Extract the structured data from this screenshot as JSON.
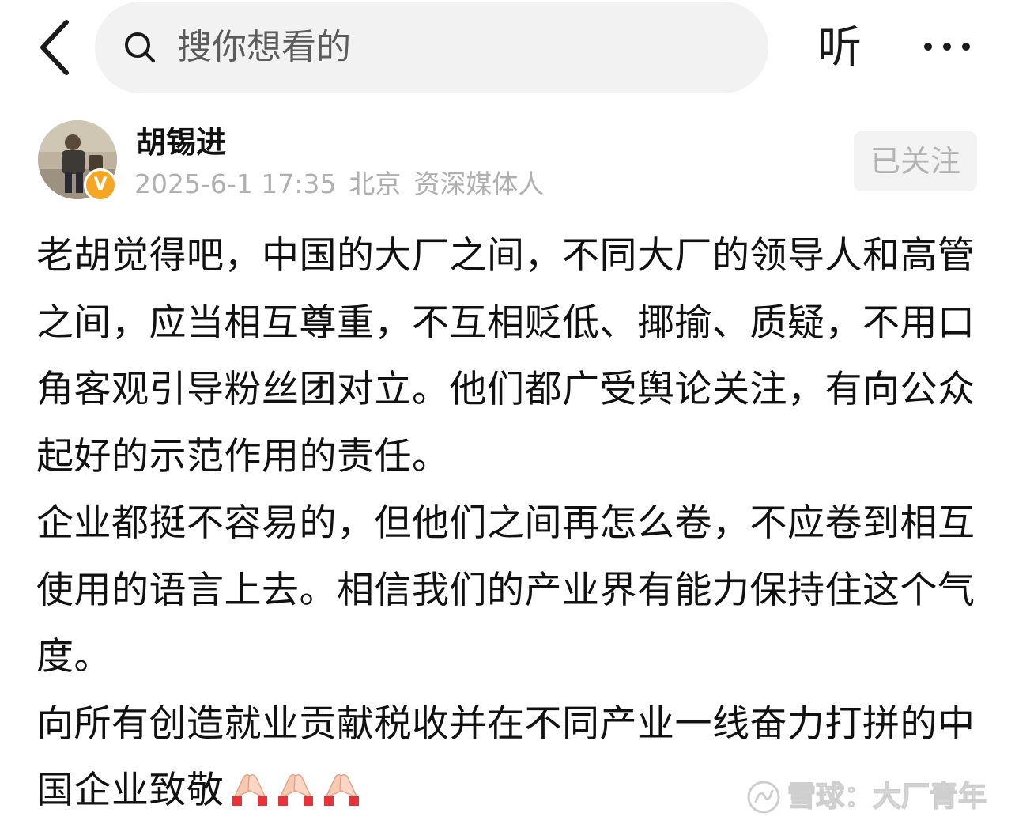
{
  "header": {
    "search_placeholder": "搜你想看的",
    "listen_label": "听"
  },
  "author": {
    "name": "胡锡进",
    "timestamp": "2025-6-1 17:35",
    "location": "北京",
    "title": "资深媒体人",
    "badge": "V",
    "follow_label": "已关注"
  },
  "post": {
    "paragraphs": [
      "老胡觉得吧，中国的大厂之间，不同大厂的领导人和高管之间，应当相互尊重，不互相贬低、揶揄、质疑，不用口角客观引导粉丝团对立。他们都广受舆论关注，有向公众起好的示范作用的责任。",
      "企业都挺不容易的，但他们之间再怎么卷，不应卷到相互使用的语言上去。相信我们的产业界有能力保持住这个气度。",
      "向所有创造就业贡献税收并在不同产业一线奋力打拼的中国企业致敬"
    ],
    "emojis": [
      "folded-hands-icon",
      "folded-hands-icon",
      "folded-hands-icon"
    ]
  },
  "watermark": {
    "text": "雪球：大厂青年"
  },
  "colors": {
    "search_bg": "#f2f2f2",
    "meta_text": "#b0b0b0",
    "badge": "#f5a623",
    "follow_bg": "#f3f3f3"
  }
}
